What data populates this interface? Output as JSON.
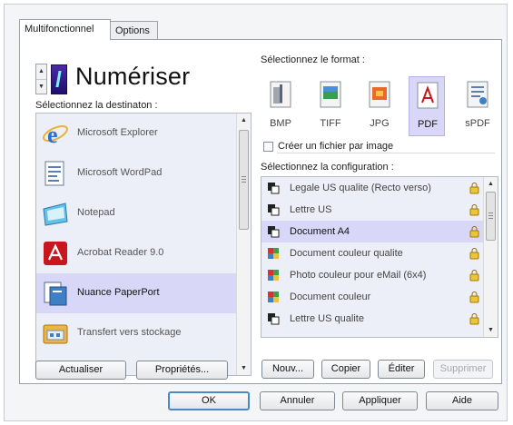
{
  "tabs": [
    "Multifonctionnel",
    "Options"
  ],
  "scan_title": "Numériser",
  "dest_label": "Sélectionnez la destinaton :",
  "destinations": [
    {
      "label": "Microsoft Explorer",
      "icon": "internet-explorer-icon"
    },
    {
      "label": "Microsoft WordPad",
      "icon": "wordpad-icon"
    },
    {
      "label": "Notepad",
      "icon": "notepad-icon"
    },
    {
      "label": "Acrobat Reader 9.0",
      "icon": "acrobat-reader-icon"
    },
    {
      "label": "Nuance PaperPort",
      "icon": "paperport-icon"
    },
    {
      "label": "Transfert vers stockage",
      "icon": "storage-transfer-icon"
    }
  ],
  "selected_destination": "Nuance PaperPort",
  "left_buttons": {
    "refresh": "Actualiser",
    "properties": "Propriétés..."
  },
  "format_label": "Sélectionnez le format :",
  "formats": [
    "BMP",
    "TIFF",
    "JPG",
    "PDF",
    "sPDF"
  ],
  "selected_format": "PDF",
  "one_file_per_image": {
    "label": "Créer un fichier par image",
    "checked": false
  },
  "config_label": "Sélectionnez la configuration :",
  "configurations": [
    {
      "label": "Legale US qualite (Recto verso)",
      "icon": "bw-document-icon"
    },
    {
      "label": "Lettre US",
      "icon": "bw-document-icon"
    },
    {
      "label": "Document A4",
      "icon": "bw-document-icon"
    },
    {
      "label": "Document couleur qualite",
      "icon": "color-document-icon"
    },
    {
      "label": "Photo couleur pour eMail (6x4)",
      "icon": "color-document-icon"
    },
    {
      "label": "Document couleur",
      "icon": "color-document-icon"
    },
    {
      "label": "Lettre US qualite",
      "icon": "bw-document-icon"
    }
  ],
  "selected_configuration": "Document A4",
  "config_buttons": {
    "new": "Nouv...",
    "copy": "Copier",
    "edit": "Éditer",
    "delete": "Supprimer"
  },
  "dialog_buttons": {
    "ok": "OK",
    "cancel": "Annuler",
    "apply": "Appliquer",
    "help": "Aide"
  },
  "colors": {
    "selection": "#d9d7f7",
    "list_background": "#eceef8",
    "dialog_background": "#f4f5f7",
    "default_button_border": "#4a88c7"
  }
}
